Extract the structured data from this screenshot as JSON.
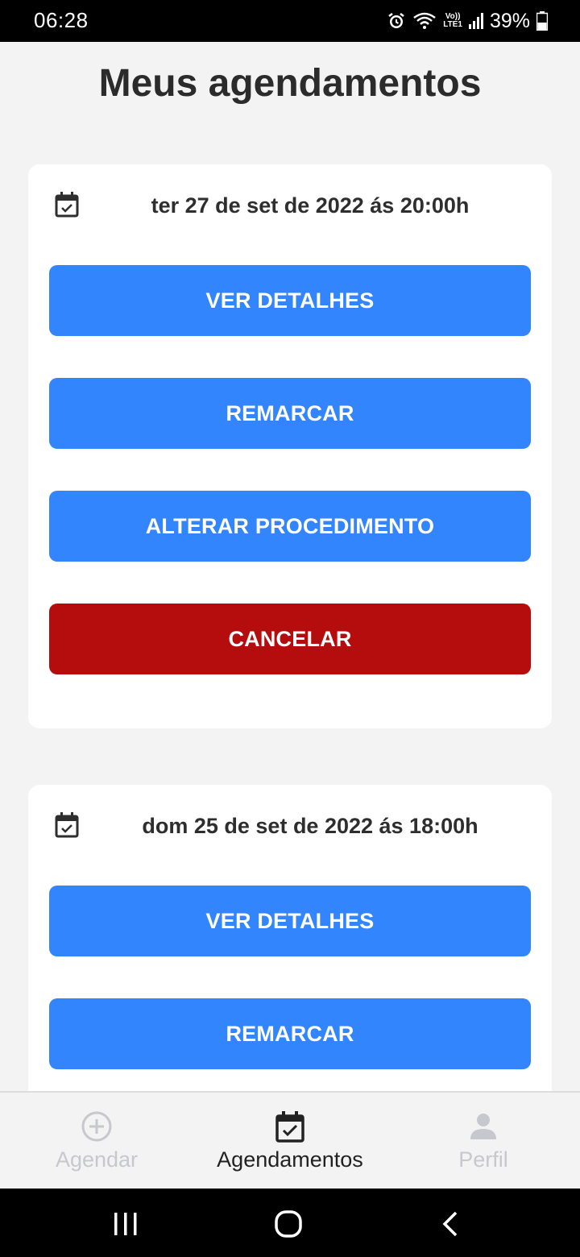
{
  "status_bar": {
    "time": "06:28",
    "battery_text": "39%",
    "lte_top": "Vo))",
    "lte_bottom": "LTE1",
    "icons": [
      "alarm-icon",
      "wifi-icon",
      "lte-icon",
      "signal-icon",
      "battery-icon"
    ]
  },
  "page": {
    "title": "Meus agendamentos"
  },
  "appointments": [
    {
      "date": "ter 27 de set de 2022 ás 20:00h",
      "icon": "calendar-check-icon",
      "buttons": {
        "details": "VER DETALHES",
        "reschedule": "REMARCAR",
        "change_procedure": "ALTERAR PROCEDIMENTO",
        "cancel": "CANCELAR"
      }
    },
    {
      "date": "dom 25 de set de 2022 ás 18:00h",
      "icon": "calendar-check-icon",
      "buttons": {
        "details": "VER DETALHES",
        "reschedule": "REMARCAR"
      }
    }
  ],
  "tab_bar": {
    "tabs": [
      {
        "label": "Agendar",
        "icon": "add-circle-icon",
        "active": false
      },
      {
        "label": "Agendamentos",
        "icon": "calendar-check-icon",
        "active": true
      },
      {
        "label": "Perfil",
        "icon": "person-icon",
        "active": false
      }
    ]
  },
  "nav_bar": {
    "buttons": [
      "recent-apps-icon",
      "home-icon",
      "back-icon"
    ]
  },
  "colors": {
    "primary": "#3385fd",
    "danger": "#b50d0d",
    "background": "#f3f3f3",
    "card": "#ffffff",
    "active_tab": "#222222",
    "inactive_tab": "#c7c7ce"
  }
}
